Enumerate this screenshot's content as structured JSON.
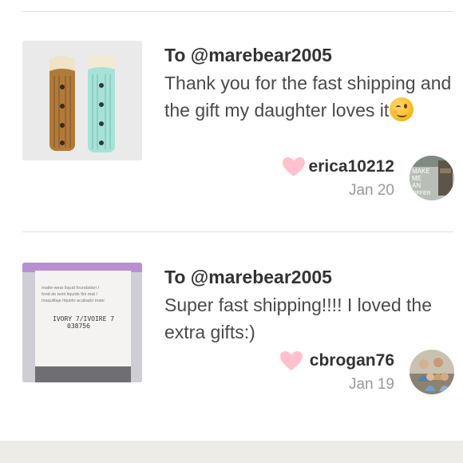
{
  "reviews": [
    {
      "to": "To @marebear2005",
      "message": "Thank you for the fast shipping and the gift my daughter loves it",
      "emoji": "winking-face",
      "username": "erica10212",
      "date": "Jan 20",
      "avatar_text": "MAKE ME AN OFFER",
      "thumbnail": "leg-warmers-photo"
    },
    {
      "to": "To @marebear2005",
      "message": "Super fast shipping!!!! I loved the extra gifts:)",
      "username": "cbrogan76",
      "date": "Jan 19",
      "thumbnail": "foundation-box-photo",
      "box_label": {
        "line1": "matte-wear liquid foundation /",
        "line2": "fond de teint liquide fini mat /",
        "line3": "maquillaje líquido acabado mate",
        "shade": "IVORY 7/IVOIRE 7",
        "code": "038756"
      }
    }
  ],
  "colors": {
    "heart": "#ffc1cc",
    "divider": "#e0e0e0",
    "date": "#999999"
  }
}
